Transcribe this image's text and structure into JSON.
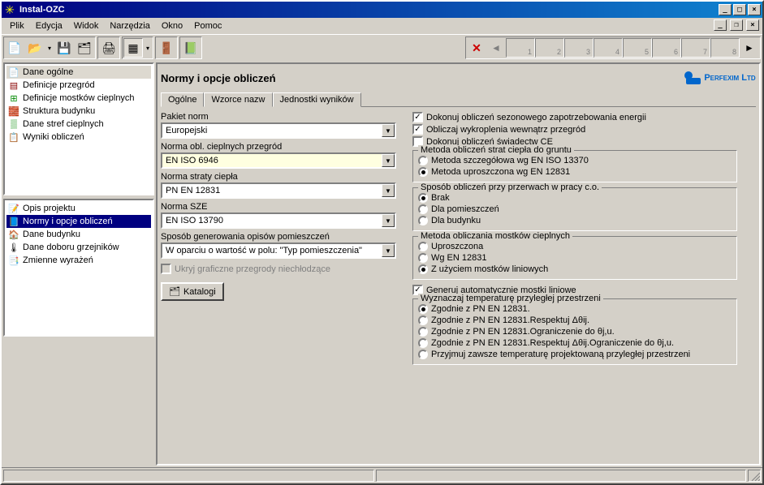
{
  "title": "Instal-OZC",
  "menu": [
    "Plik",
    "Edycja",
    "Widok",
    "Narzędzia",
    "Okno",
    "Pomoc"
  ],
  "nav_tabs": [
    "1",
    "2",
    "3",
    "4",
    "5",
    "6",
    "7",
    "8"
  ],
  "tree1": [
    {
      "label": "Dane ogólne"
    },
    {
      "label": "Definicje przegród"
    },
    {
      "label": "Definicje mostków cieplnych"
    },
    {
      "label": "Struktura budynku"
    },
    {
      "label": "Dane stref cieplnych"
    },
    {
      "label": "Wyniki obliczeń"
    }
  ],
  "tree2": [
    {
      "label": "Opis projektu"
    },
    {
      "label": "Normy i opcje obliczeń"
    },
    {
      "label": "Dane budynku"
    },
    {
      "label": "Dane doboru grzejników"
    },
    {
      "label": "Zmienne wyrażeń"
    }
  ],
  "page": {
    "title": "Normy i opcje obliczeń",
    "tabs": [
      "Ogólne",
      "Wzorce nazw",
      "Jednostki wyników"
    ],
    "pakiet_label": "Pakiet norm",
    "pakiet_val": "Europejski",
    "norma_przegrod_label": "Norma obl. cieplnych przegród",
    "norma_przegrod_val": "EN ISO 6946",
    "norma_straty_label": "Norma straty ciepła",
    "norma_straty_val": "PN EN 12831",
    "norma_sze_label": "Norma SZE",
    "norma_sze_val": "EN ISO 13790",
    "sposob_label": "Sposób generowania opisów pomieszczeń",
    "sposob_val": "W oparciu o wartość w polu: \"Typ pomieszczenia\"",
    "ukryj_label": "Ukryj graficzne przegrody niechłodzące",
    "katalog_btn": "Katalogi",
    "chk_sezon": "Dokonuj obliczeń sezonowego zapotrzebowania energii",
    "chk_wykrop": "Obliczaj wykroplenia wewnątrz przegród",
    "chk_ce": "Dokonuj obliczeń świadectw CE",
    "grp_grunt": "Metoda obliczeń strat ciepła do gruntu",
    "rad_grunt1": "Metoda szczegółowa wg EN ISO 13370",
    "rad_grunt2": "Metoda uproszczona wg EN 12831",
    "grp_przerwy": "Sposób obliczeń przy przerwach w pracy c.o.",
    "rad_p1": "Brak",
    "rad_p2": "Dla pomieszczeń",
    "rad_p3": "Dla budynku",
    "grp_mostki": "Metoda obliczania mostków cieplnych",
    "rad_m1": "Uproszczona",
    "rad_m2": "Wg EN 12831",
    "rad_m3": "Z użyciem mostków liniowych",
    "chk_gen": "Generuj automatycznie mostki liniowe",
    "grp_temp": "Wyznaczaj temperaturę przyległej przestrzeni",
    "rad_t1": "Zgodnie z PN EN 12831.",
    "rad_t2": "Zgodnie z PN EN 12831.Respektuj Δθij.",
    "rad_t3": "Zgodnie z PN EN 12831.Ograniczenie do θj,u.",
    "rad_t4": "Zgodnie z PN EN 12831.Respektuj Δθij.Ograniczenie do θj,u.",
    "rad_t5": "Przyjmuj zawsze temperaturę projektowaną przyległej przestrzeni"
  },
  "logo": "Perfexim Ltd"
}
